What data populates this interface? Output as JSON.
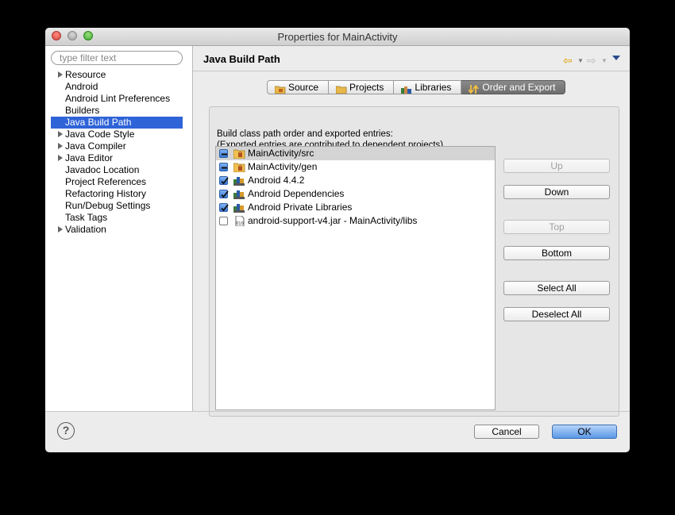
{
  "window": {
    "title": "Properties for MainActivity"
  },
  "sidebar": {
    "filter_placeholder": "type filter text",
    "items": [
      {
        "label": "Resource",
        "expandable": true
      },
      {
        "label": "Android",
        "expandable": false
      },
      {
        "label": "Android Lint Preferences",
        "expandable": false
      },
      {
        "label": "Builders",
        "expandable": false
      },
      {
        "label": "Java Build Path",
        "expandable": false,
        "selected": true
      },
      {
        "label": "Java Code Style",
        "expandable": true
      },
      {
        "label": "Java Compiler",
        "expandable": true
      },
      {
        "label": "Java Editor",
        "expandable": true
      },
      {
        "label": "Javadoc Location",
        "expandable": false
      },
      {
        "label": "Project References",
        "expandable": false
      },
      {
        "label": "Refactoring History",
        "expandable": false
      },
      {
        "label": "Run/Debug Settings",
        "expandable": false
      },
      {
        "label": "Task Tags",
        "expandable": false
      },
      {
        "label": "Validation",
        "expandable": true
      }
    ]
  },
  "page": {
    "title": "Java Build Path",
    "tabs": [
      {
        "label": "Source",
        "icon": "folder-package-icon"
      },
      {
        "label": "Projects",
        "icon": "folder-icon"
      },
      {
        "label": "Libraries",
        "icon": "library-icon"
      },
      {
        "label": "Order and Export",
        "icon": "order-export-icon",
        "active": true
      }
    ],
    "description_line1": "Build class path order and exported entries:",
    "description_line2": "(Exported entries are contributed to dependent projects)",
    "entries": [
      {
        "label": "MainActivity/src",
        "state": "mixed",
        "icon": "source-folder-icon",
        "selected": true
      },
      {
        "label": "MainActivity/gen",
        "state": "mixed",
        "icon": "source-folder-icon"
      },
      {
        "label": "Android 4.4.2",
        "state": "checked",
        "icon": "library-icon"
      },
      {
        "label": "Android Dependencies",
        "state": "checked",
        "icon": "library-icon"
      },
      {
        "label": "Android Private Libraries",
        "state": "checked",
        "icon": "library-icon"
      },
      {
        "label": "android-support-v4.jar - MainActivity/libs",
        "state": "unchecked",
        "icon": "jar-icon"
      }
    ],
    "buttons": {
      "up": "Up",
      "down": "Down",
      "top": "Top",
      "bottom": "Bottom",
      "select_all": "Select All",
      "deselect_all": "Deselect All"
    }
  },
  "footer": {
    "help": "?",
    "cancel": "Cancel",
    "ok": "OK"
  }
}
